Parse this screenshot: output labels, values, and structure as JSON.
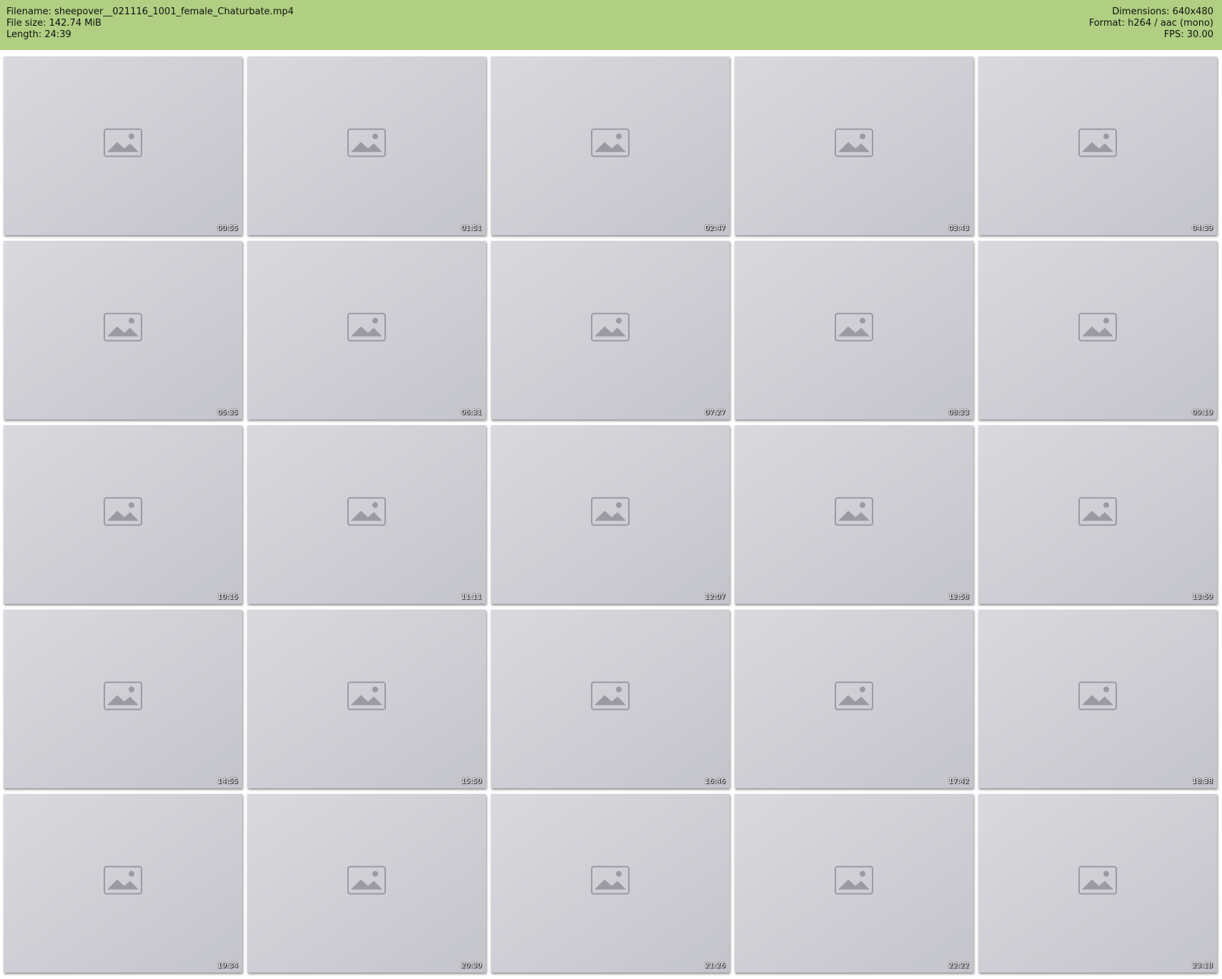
{
  "header": {
    "filename": "Filename: sheepover__021116_1001_female_Chaturbate.mp4",
    "filesize": "File size: 142.74 MiB",
    "length": "Length: 24:39",
    "dimensions": "Dimensions: 640x480",
    "format": "Format: h264 / aac (mono)",
    "fps": "FPS: 30.00",
    "background_color": "#b0cf82"
  },
  "thumbnails": [
    {
      "timestamp": "00:55"
    },
    {
      "timestamp": "01:51"
    },
    {
      "timestamp": "02:47"
    },
    {
      "timestamp": "03:43"
    },
    {
      "timestamp": "04:39"
    },
    {
      "timestamp": "05:35"
    },
    {
      "timestamp": "06:31"
    },
    {
      "timestamp": "07:27"
    },
    {
      "timestamp": "08:23"
    },
    {
      "timestamp": "09:19"
    },
    {
      "timestamp": "10:15"
    },
    {
      "timestamp": "11:11"
    },
    {
      "timestamp": "12:07"
    },
    {
      "timestamp": "12:58"
    },
    {
      "timestamp": "13:59"
    },
    {
      "timestamp": "14:55"
    },
    {
      "timestamp": "15:50"
    },
    {
      "timestamp": "16:46"
    },
    {
      "timestamp": "17:42"
    },
    {
      "timestamp": "18:38"
    },
    {
      "timestamp": "19:34"
    },
    {
      "timestamp": "20:30"
    },
    {
      "timestamp": "21:26"
    },
    {
      "timestamp": "22:22"
    },
    {
      "timestamp": "23:18"
    }
  ]
}
